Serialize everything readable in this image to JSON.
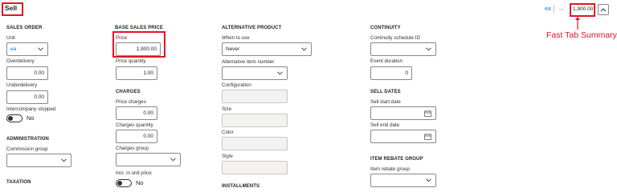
{
  "header": {
    "title": "Sell",
    "summary_uom": "ea",
    "summary_ellipsis": "...",
    "summary_price": "1,900.00",
    "collapse_icon": "chevron-up-icon"
  },
  "annotation": {
    "label": "Fast Tab Summary",
    "color": "#e81123"
  },
  "sales_order": {
    "heading": "SALES ORDER",
    "unit_label": "Unit",
    "unit_value": "ea",
    "overdelivery_label": "Overdelivery",
    "overdelivery_value": "0.00",
    "underdelivery_label": "Underdelivery",
    "underdelivery_value": "0.00",
    "intercompany_label": "Intercompany stopped",
    "intercompany_value": "No"
  },
  "administration": {
    "heading": "ADMINISTRATION",
    "commission_label": "Commission group",
    "commission_value": ""
  },
  "taxation": {
    "heading": "TAXATION"
  },
  "base_sales_price": {
    "heading": "BASE SALES PRICE",
    "price_label": "Price",
    "price_value": "1,900.00",
    "price_qty_label": "Price quantity",
    "price_qty_value": "1.00"
  },
  "charges": {
    "heading": "CHARGES",
    "price_charges_label": "Price charges",
    "price_charges_value": "0.00",
    "charges_qty_label": "Charges quantity",
    "charges_qty_value": "0.00",
    "charges_group_label": "Charges group",
    "charges_group_value": "",
    "incl_label": "Incl. in unit price",
    "incl_value": "No"
  },
  "alternative_product": {
    "heading": "ALTERNATIVE PRODUCT",
    "when_label": "When to use",
    "when_value": "Never",
    "alt_item_label": "Alternative item number",
    "alt_item_value": "",
    "configuration_label": "Configuration",
    "size_label": "Size",
    "color_label": "Color",
    "style_label": "Style"
  },
  "installments": {
    "heading": "INSTALLMENTS"
  },
  "continuity": {
    "heading": "CONTINUITY",
    "schedule_label": "Continuity schedule ID",
    "schedule_value": "",
    "event_label": "Event duration",
    "event_value": "0"
  },
  "sell_dates": {
    "heading": "SELL DATES",
    "start_label": "Sell start date",
    "start_value": "",
    "end_label": "Sell end date",
    "end_value": ""
  },
  "item_rebate_group": {
    "heading": "ITEM REBATE GROUP",
    "rebate_label": "Item rebate group",
    "rebate_value": ""
  }
}
